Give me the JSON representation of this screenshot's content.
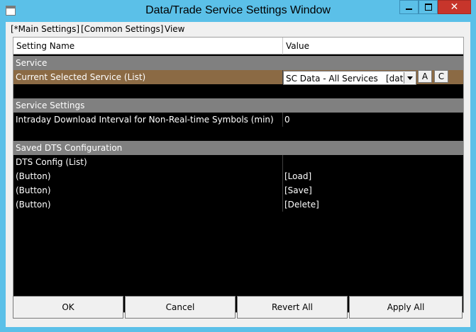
{
  "window": {
    "title": "Data/Trade Service Settings Window",
    "close_glyph": "✕"
  },
  "menu": {
    "items": [
      "[*Main Settings]",
      "[Common Settings]",
      "View"
    ]
  },
  "grid": {
    "columns": [
      "Setting Name",
      "Value"
    ],
    "sections": {
      "service": "Service",
      "service_settings": "Service Settings",
      "saved_dts": "Saved DTS Configuration"
    },
    "rows": {
      "current_service": {
        "name": "Current Selected Service (List)",
        "value": "SC Data - All Services",
        "extra": "[data",
        "btn_a": "A",
        "btn_c": "C"
      },
      "intraday_interval": {
        "name": "Intraday Download Interval for Non-Real-time Symbols (min)",
        "value": "0"
      },
      "dts_config": {
        "name": "DTS Config (List)",
        "value": ""
      },
      "load": {
        "name": "(Button)",
        "value": "[Load]"
      },
      "save": {
        "name": "(Button)",
        "value": "[Save]"
      },
      "delete": {
        "name": "(Button)",
        "value": "[Delete]"
      }
    }
  },
  "footer": {
    "ok": "OK",
    "cancel": "Cancel",
    "revert_all": "Revert All",
    "apply_all": "Apply All"
  },
  "colors": {
    "title_bar": "#5bc0e8",
    "close_button": "#c7352b",
    "section_row": "#808080",
    "selected_row": "#8b6a44",
    "grid_bg": "#000000"
  }
}
